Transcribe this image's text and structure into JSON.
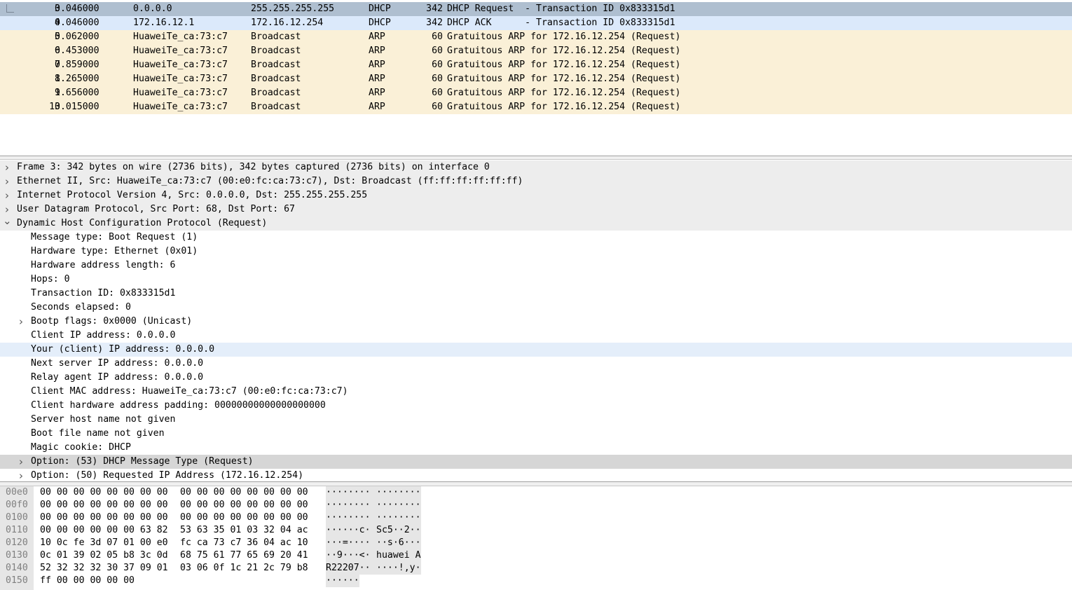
{
  "packets": [
    {
      "no": "3",
      "time": "0.046000",
      "src": "0.0.0.0",
      "dst": "255.255.255.255",
      "proto": "DHCP",
      "len": "342",
      "info": "DHCP Request  - Transaction ID 0x833315d1"
    },
    {
      "no": "4",
      "time": "0.046000",
      "src": "172.16.12.1",
      "dst": "172.16.12.254",
      "proto": "DHCP",
      "len": "342",
      "info": "DHCP ACK      - Transaction ID 0x833315d1"
    },
    {
      "no": "5",
      "time": "0.062000",
      "src": "HuaweiTe_ca:73:c7",
      "dst": "Broadcast",
      "proto": "ARP",
      "len": "60",
      "info": "Gratuitous ARP for 172.16.12.254 (Request)"
    },
    {
      "no": "6",
      "time": "0.453000",
      "src": "HuaweiTe_ca:73:c7",
      "dst": "Broadcast",
      "proto": "ARP",
      "len": "60",
      "info": "Gratuitous ARP for 172.16.12.254 (Request)"
    },
    {
      "no": "7",
      "time": "0.859000",
      "src": "HuaweiTe_ca:73:c7",
      "dst": "Broadcast",
      "proto": "ARP",
      "len": "60",
      "info": "Gratuitous ARP for 172.16.12.254 (Request)"
    },
    {
      "no": "8",
      "time": "1.265000",
      "src": "HuaweiTe_ca:73:c7",
      "dst": "Broadcast",
      "proto": "ARP",
      "len": "60",
      "info": "Gratuitous ARP for 172.16.12.254 (Request)"
    },
    {
      "no": "9",
      "time": "1.656000",
      "src": "HuaweiTe_ca:73:c7",
      "dst": "Broadcast",
      "proto": "ARP",
      "len": "60",
      "info": "Gratuitous ARP for 172.16.12.254 (Request)"
    },
    {
      "no": "10",
      "time": "3.015000",
      "src": "HuaweiTe_ca:73:c7",
      "dst": "Broadcast",
      "proto": "ARP",
      "len": "60",
      "info": "Gratuitous ARP for 172.16.12.254 (Request)"
    }
  ],
  "detail": [
    {
      "text": "Frame 3: 342 bytes on wire (2736 bits), 342 bytes captured (2736 bits) on interface 0",
      "level": 0,
      "expander": "collapsed"
    },
    {
      "text": "Ethernet II, Src: HuaweiTe_ca:73:c7 (00:e0:fc:ca:73:c7), Dst: Broadcast (ff:ff:ff:ff:ff:ff)",
      "level": 0,
      "expander": "collapsed"
    },
    {
      "text": "Internet Protocol Version 4, Src: 0.0.0.0, Dst: 255.255.255.255",
      "level": 0,
      "expander": "collapsed"
    },
    {
      "text": "User Datagram Protocol, Src Port: 68, Dst Port: 67",
      "level": 0,
      "expander": "collapsed"
    },
    {
      "text": "Dynamic Host Configuration Protocol (Request)",
      "level": 0,
      "expander": "expanded"
    },
    {
      "text": "Message type: Boot Request (1)",
      "level": 1,
      "expander": "none"
    },
    {
      "text": "Hardware type: Ethernet (0x01)",
      "level": 1,
      "expander": "none"
    },
    {
      "text": "Hardware address length: 6",
      "level": 1,
      "expander": "none"
    },
    {
      "text": "Hops: 0",
      "level": 1,
      "expander": "none"
    },
    {
      "text": "Transaction ID: 0x833315d1",
      "level": 1,
      "expander": "none"
    },
    {
      "text": "Seconds elapsed: 0",
      "level": 1,
      "expander": "none"
    },
    {
      "text": "Bootp flags: 0x0000 (Unicast)",
      "level": 1,
      "expander": "collapsed"
    },
    {
      "text": "Client IP address: 0.0.0.0",
      "level": 1,
      "expander": "none"
    },
    {
      "text": "Your (client) IP address: 0.0.0.0",
      "level": 1,
      "expander": "none"
    },
    {
      "text": "Next server IP address: 0.0.0.0",
      "level": 1,
      "expander": "none"
    },
    {
      "text": "Relay agent IP address: 0.0.0.0",
      "level": 1,
      "expander": "none"
    },
    {
      "text": "Client MAC address: HuaweiTe_ca:73:c7 (00:e0:fc:ca:73:c7)",
      "level": 1,
      "expander": "none"
    },
    {
      "text": "Client hardware address padding: 00000000000000000000",
      "level": 1,
      "expander": "none"
    },
    {
      "text": "Server host name not given",
      "level": 1,
      "expander": "none"
    },
    {
      "text": "Boot file name not given",
      "level": 1,
      "expander": "none"
    },
    {
      "text": "Magic cookie: DHCP",
      "level": 1,
      "expander": "none"
    },
    {
      "text": "Option: (53) DHCP Message Type (Request)",
      "level": 1,
      "expander": "collapsed"
    },
    {
      "text": "Option: (50) Requested IP Address (172.16.12.254)",
      "level": 1,
      "expander": "collapsed"
    }
  ],
  "hex": [
    {
      "offset": "00e0",
      "b1": "00 00 00 00 00 00 00 00",
      "b2": "00 00 00 00 00 00 00 00",
      "a1": "········",
      "a2": "········"
    },
    {
      "offset": "00f0",
      "b1": "00 00 00 00 00 00 00 00",
      "b2": "00 00 00 00 00 00 00 00",
      "a1": "········",
      "a2": "········"
    },
    {
      "offset": "0100",
      "b1": "00 00 00 00 00 00 00 00",
      "b2": "00 00 00 00 00 00 00 00",
      "a1": "········",
      "a2": "········"
    },
    {
      "offset": "0110",
      "b1": "00 00 00 00 00 00 63 82",
      "b2": "53 63 35 01 03 32 04 ac",
      "a1": "······c·",
      "a2": "Sc5··2··"
    },
    {
      "offset": "0120",
      "b1": "10 0c fe 3d 07 01 00 e0",
      "b2": "fc ca 73 c7 36 04 ac 10",
      "a1": "···=····",
      "a2": "··s·6···"
    },
    {
      "offset": "0130",
      "b1": "0c 01 39 02 05 b8 3c 0d",
      "b2": "68 75 61 77 65 69 20 41",
      "a1": "··9···<·",
      "a2": "huawei A"
    },
    {
      "offset": "0140",
      "b1": "52 32 32 32 30 37 09 01",
      "b2": "03 06 0f 1c 21 2c 79 b8",
      "a1": "R22207··",
      "a2": "····!,y·"
    },
    {
      "offset": "0150",
      "b1": "ff 00 00 00 00 00",
      "b2": "",
      "a1": "······",
      "a2": ""
    }
  ]
}
